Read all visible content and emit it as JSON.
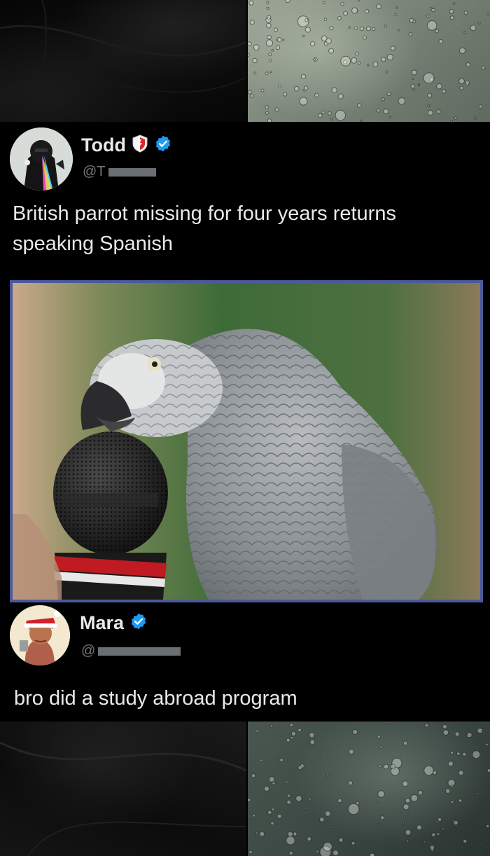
{
  "post": {
    "author": {
      "name": "Todd",
      "handle": "@T"
    },
    "text": "British parrot missing for four years returns speaking Spanish",
    "media_alt": "Grey parrot speaking into a microphone"
  },
  "reply": {
    "author": {
      "name": "Mara",
      "handle": "@"
    },
    "text": "bro did a study abroad program"
  },
  "colors": {
    "verified": "#1d9bf0",
    "text": "#e7e9ea",
    "muted": "#71767b",
    "media_border": "#4a5a9a"
  }
}
